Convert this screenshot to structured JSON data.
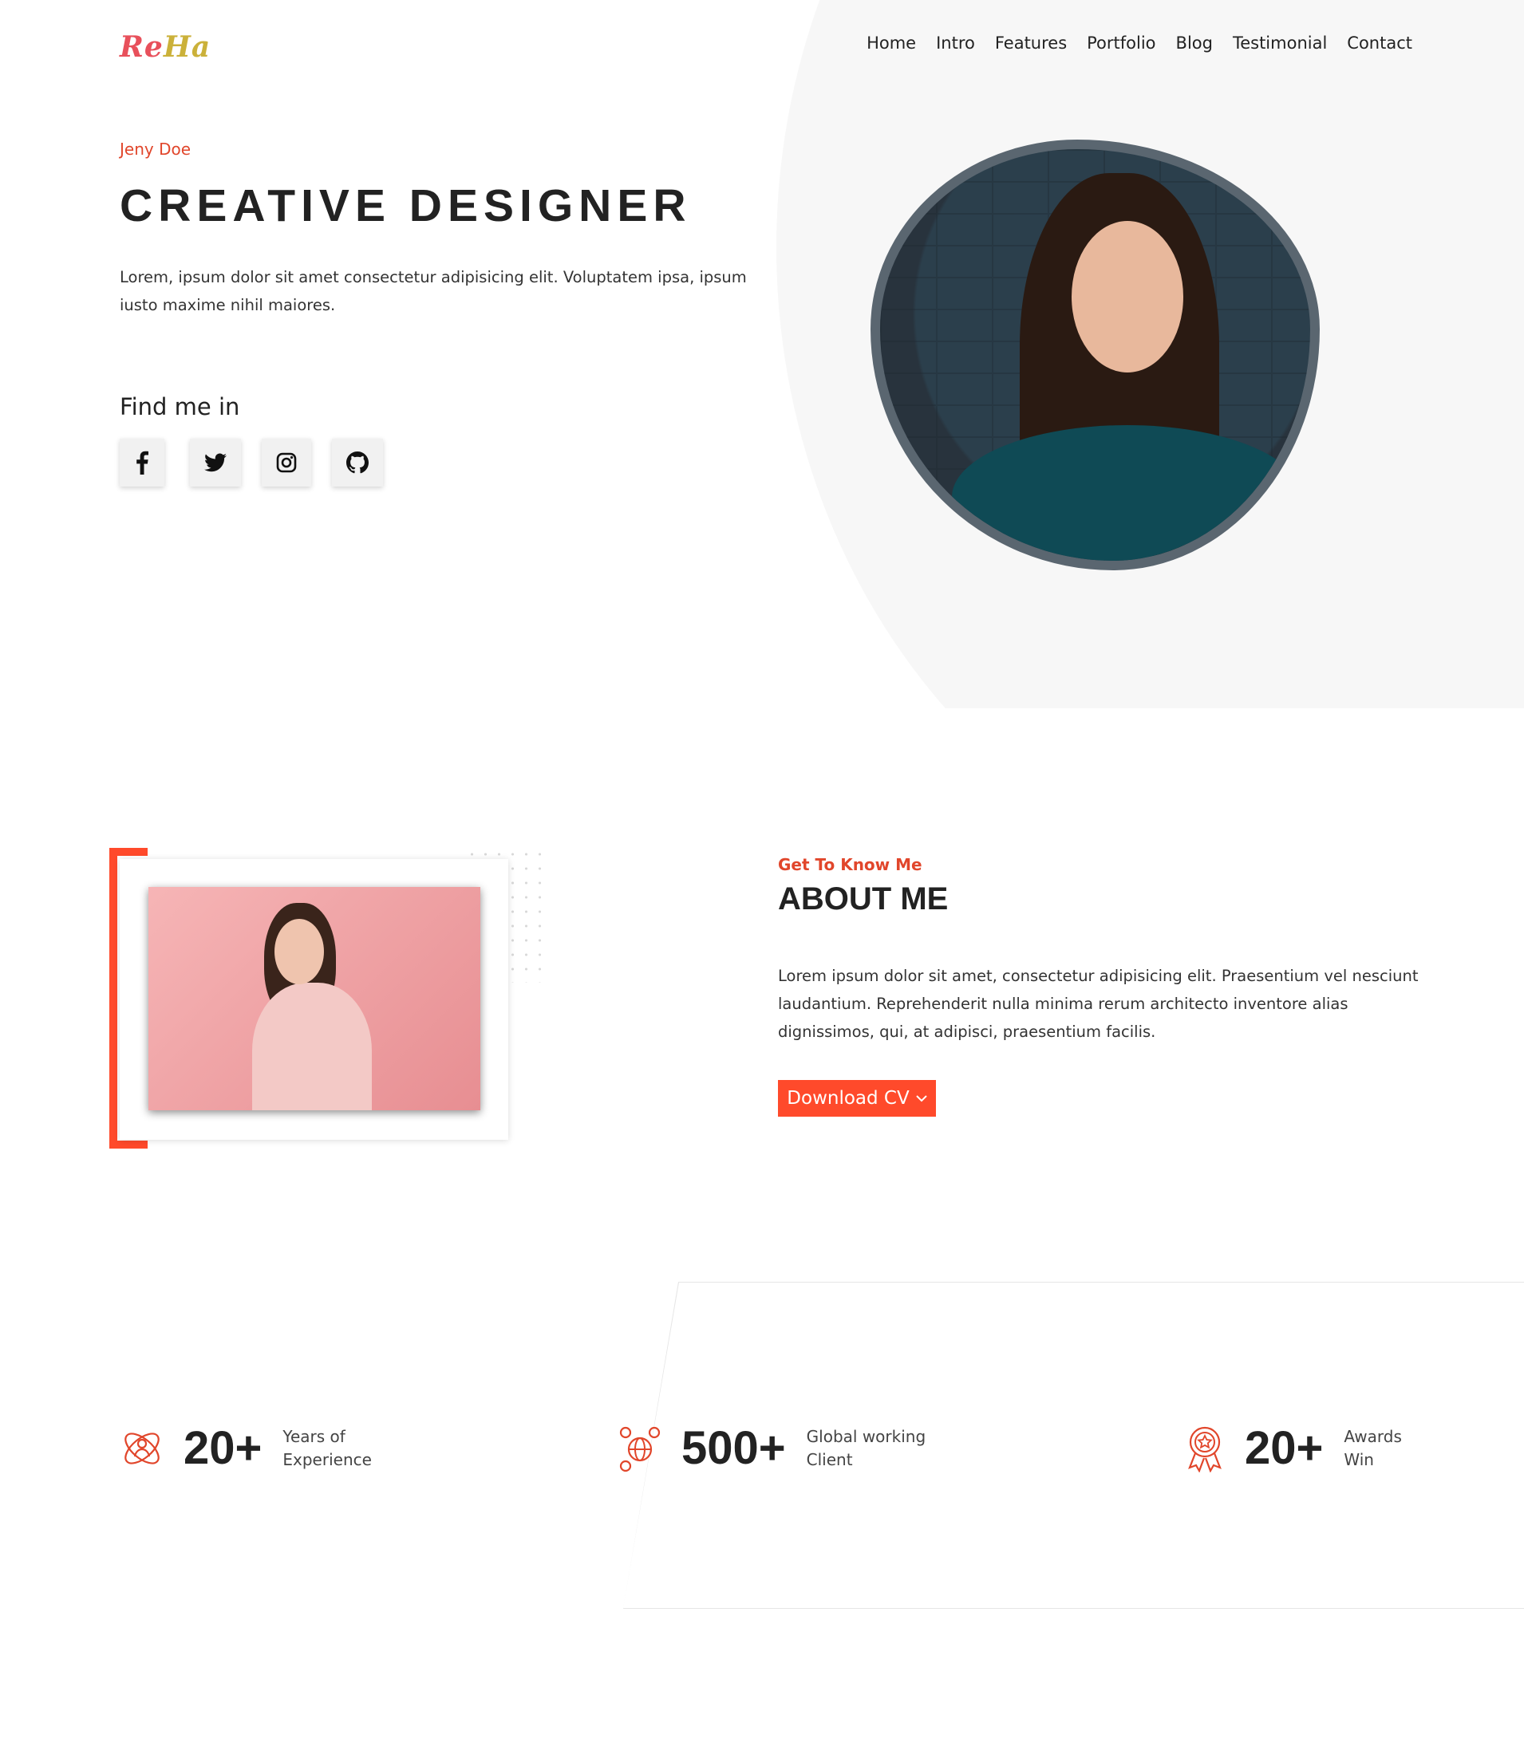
{
  "brand": {
    "logo_part1": "Re",
    "logo_part2": "Ha"
  },
  "nav": {
    "items": [
      "Home",
      "Intro",
      "Features",
      "Portfolio",
      "Blog",
      "Testimonial",
      "Contact"
    ]
  },
  "hero": {
    "eyebrow": "Jeny Doe",
    "title": "CREATIVE DESIGNER",
    "description": "Lorem, ipsum dolor sit amet consectetur adipisicing elit. Voluptatem ipsa, ipsum iusto maxime nihil maiores.",
    "find_me_label": "Find me in",
    "socials": [
      "facebook-icon",
      "twitter-icon",
      "instagram-icon",
      "github-icon"
    ]
  },
  "about": {
    "eyebrow": "Get To Know Me",
    "title": "ABOUT ME",
    "description": "Lorem ipsum dolor sit amet, consectetur adipisicing elit. Praesentium vel nesciunt laudantium. Reprehenderit nulla minima rerum architecto inventore alias dignissimos, qui, at adipisci, praesentium facilis.",
    "cv_button_label": "Download CV"
  },
  "stats": [
    {
      "icon": "team-network-icon",
      "value": "20+",
      "label_line1": "Years of",
      "label_line2": "Experience"
    },
    {
      "icon": "global-network-icon",
      "value": "500+",
      "label_line1": "Global working",
      "label_line2": "Client"
    },
    {
      "icon": "award-medal-icon",
      "value": "20+",
      "label_line1": "Awards",
      "label_line2": "Win"
    }
  ],
  "colors": {
    "accent": "#ff4a2b",
    "text": "#222222",
    "hero_bg": "#f7f7f7",
    "logo_red": "#e8505b",
    "logo_gold": "#cbb13a"
  }
}
